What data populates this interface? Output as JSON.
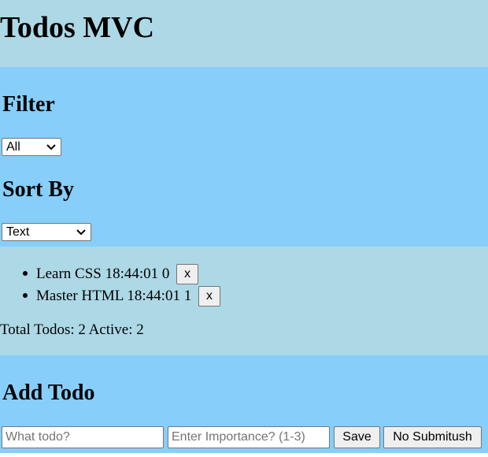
{
  "header": {
    "title": "Todos MVC"
  },
  "filter": {
    "heading": "Filter",
    "selected": "All"
  },
  "sort": {
    "heading": "Sort By",
    "selected": "Text"
  },
  "todos": [
    {
      "text": "Learn CSS 18:44:01 0",
      "remove_label": "x"
    },
    {
      "text": "Master HTML 18:44:01 1",
      "remove_label": "x"
    }
  ],
  "stats": {
    "summary": "Total Todos: 2 Active: 2"
  },
  "add_todo": {
    "heading": "Add Todo",
    "text_placeholder": "What todo?",
    "importance_placeholder": "Enter Importance? (1-3)",
    "save_label": "Save",
    "no_submit_label": "No Submitush"
  }
}
